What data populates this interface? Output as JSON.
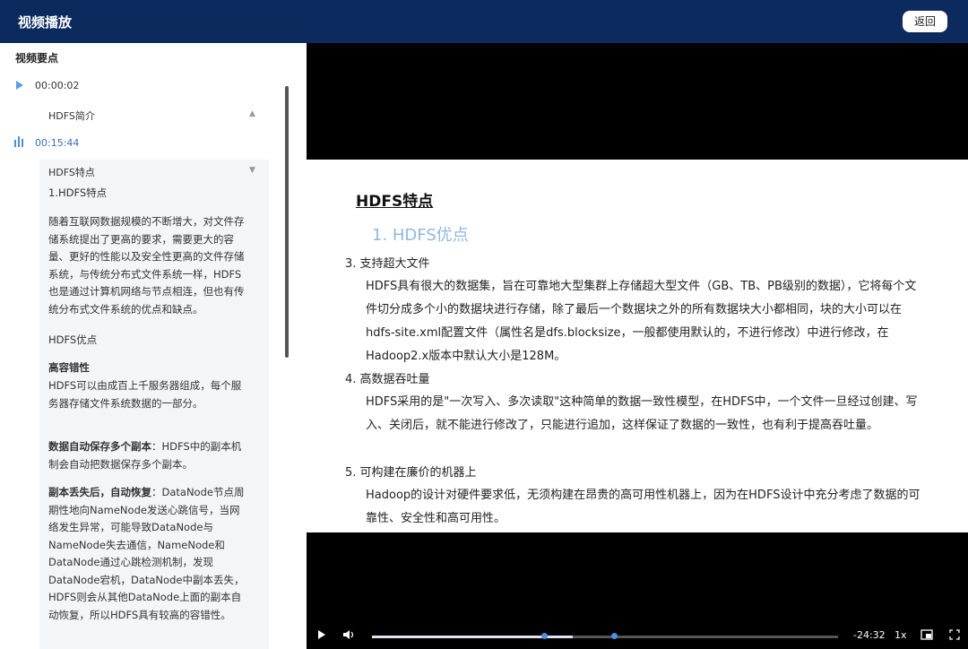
{
  "header": {
    "title": "视频播放",
    "back_label": "返回"
  },
  "sidebar": {
    "heading": "视频要点",
    "entries": [
      {
        "time": "00:00:02",
        "title": "HDFS简介"
      },
      {
        "time": "00:15:44",
        "title": "HDFS特点"
      }
    ],
    "content": {
      "point_title": "1.HDFS特点",
      "intro": "随着互联网数据规模的不断增大，对文件存储系统提出了更高的要求，需要更大的容量、更好的性能以及安全性更高的文件存储系统，与传统分布式文件系统一样，HDFS也是通过计算机网络与节点相连，但也有传统分布式文件系统的优点和缺点。",
      "pros_label": "HDFS优点",
      "fault_title": "高容错性",
      "fault_text": "HDFS可以由成百上千服务器组成，每个服务器存储文件系统数据的一部分。",
      "replica_bold": "数据自动保存多个副本",
      "replica_text": "：HDFS中的副本机制会自动把数据保存多个副本。",
      "recover_bold": "副本丢失后，自动恢复",
      "recover_text": "：DataNode节点周期性地向NameNode发送心跳信号，当网络发生异常，可能导致DataNode与NameNode失去通信，NameNode和DataNode通过心跳检测机制，发现DataNode宕机，DataNode中副本丢失，HDFS则会从其他DataNode上面的副本自动恢复，所以HDFS具有较高的容错性。"
    }
  },
  "slide": {
    "title": "HDFS特点",
    "subtitle": "1. HDFS优点",
    "items": [
      {
        "heading": "3. 支持超大文件",
        "body": "HDFS具有很大的数据集，旨在可靠地大型集群上存储超大型文件（GB、TB、PB级别的数据），它将每个文件切分成多个小的数据块进行存储，除了最后一个数据块之外的所有数据块大小都相同，块的大小可以在hdfs-site.xml配置文件（属性名是dfs.blocksize，一般都使用默认的，不进行修改）中进行修改，在Hadoop2.x版本中默认大小是128M。"
      },
      {
        "heading": "4. 高数据吞吐量",
        "body": "HDFS采用的是\"一次写入、多次读取\"这种简单的数据一致性模型，在HDFS中，一个文件一旦经过创建、写入、关闭后，就不能进行修改了，只能进行追加，这样保证了数据的一致性，也有利于提高吞吐量。"
      },
      {
        "heading": "5. 可构建在廉价的机器上",
        "body": "Hadoop的设计对硬件要求低，无须构建在昂贵的高可用性机器上，因为在HDFS设计中充分考虑了数据的可靠性、安全性和高可用性。"
      }
    ]
  },
  "player": {
    "time_remaining": "-24:32",
    "speed": "1x",
    "progress_fraction": 0.43,
    "marker_fractions": [
      0.37,
      0.52
    ],
    "play_icon": "play-icon",
    "volume_icon": "volume-icon",
    "pip_icon": "pip-icon",
    "fullscreen_icon": "fullscreen-icon"
  },
  "colors": {
    "header": "#0d2a5e",
    "accent": "#4a8fe0"
  }
}
